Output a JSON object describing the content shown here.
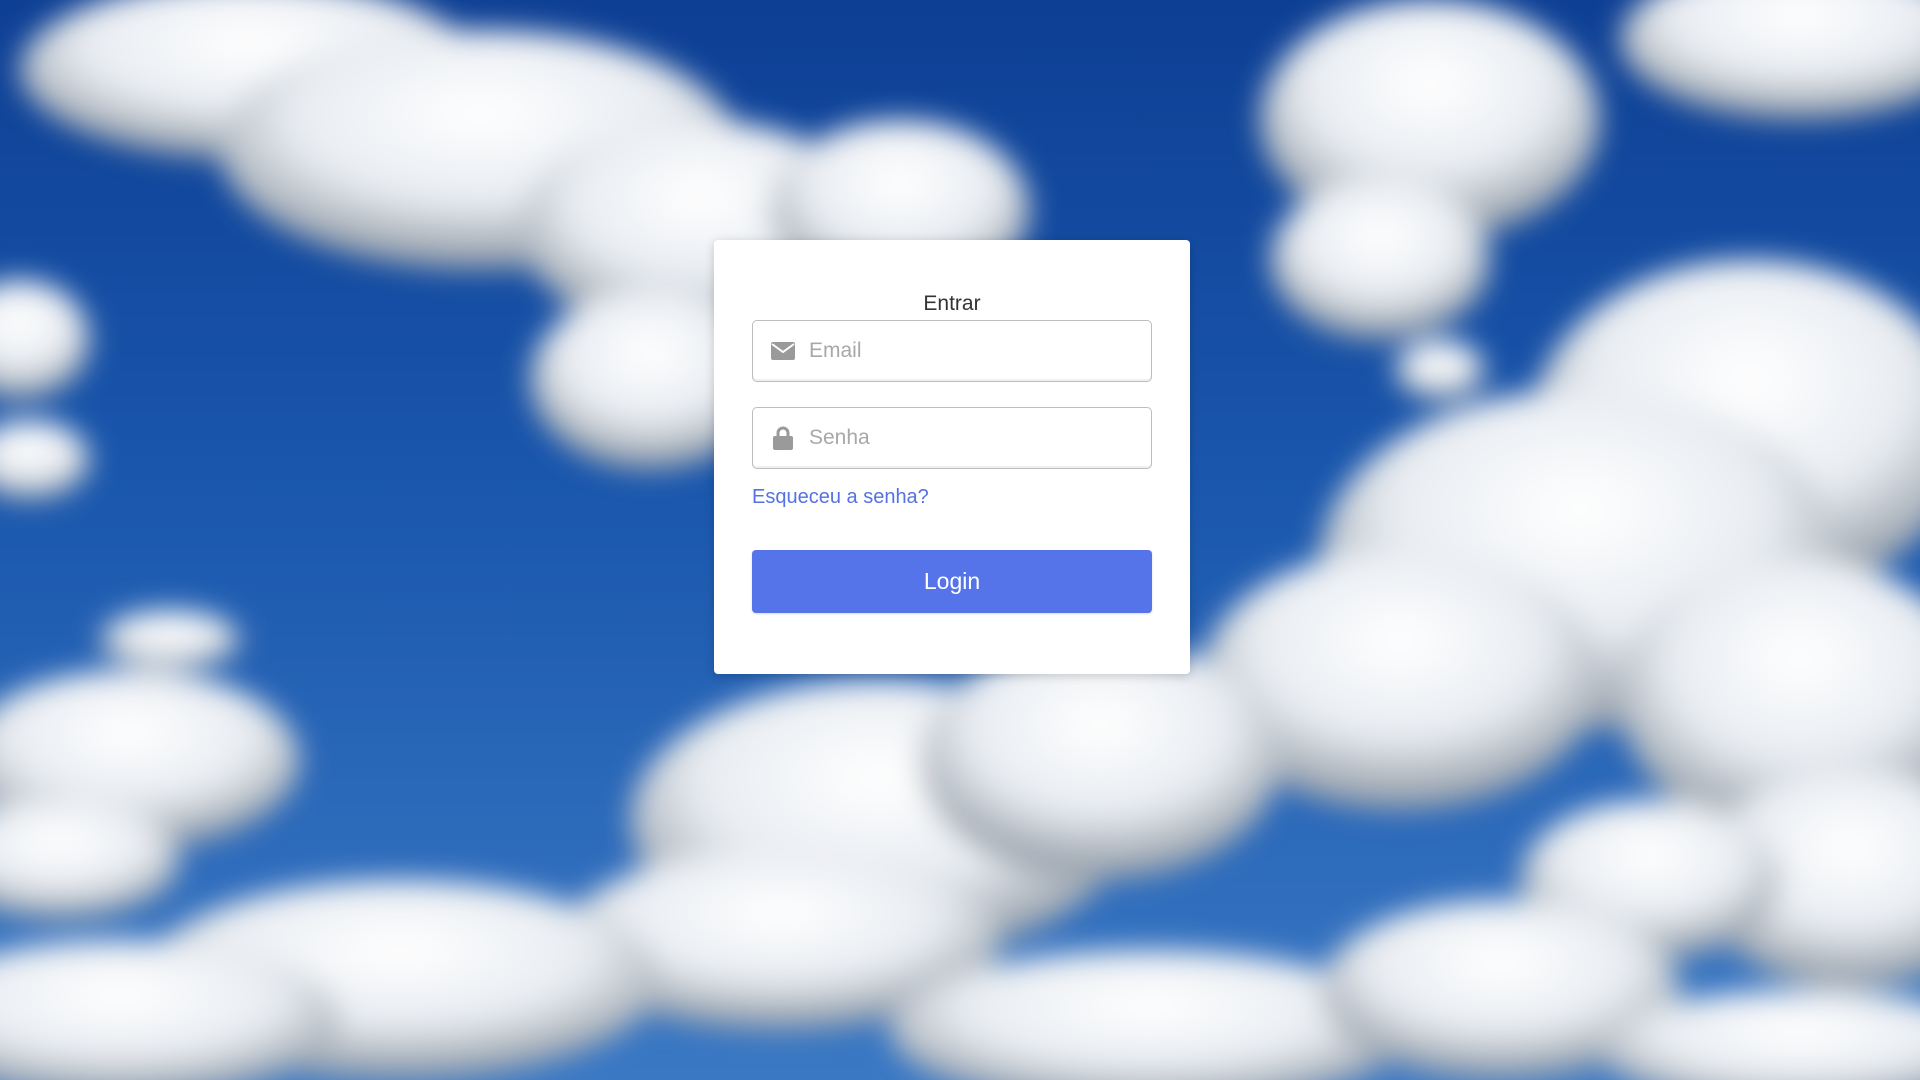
{
  "login_form": {
    "title": "Entrar",
    "email": {
      "placeholder": "Email",
      "value": "",
      "icon": "envelope-icon"
    },
    "password": {
      "placeholder": "Senha",
      "value": "",
      "icon": "lock-icon"
    },
    "forgot_password_link": "Esqueceu a senha?",
    "login_button": "Login"
  },
  "colors": {
    "accent": "#5674ea",
    "link": "#5472e4",
    "card_background": "#ffffff",
    "sky_blue": "#1a57ad"
  }
}
